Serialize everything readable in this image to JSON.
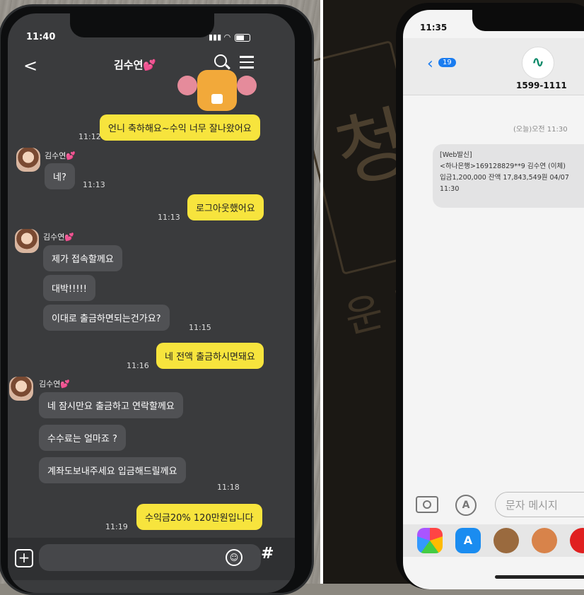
{
  "left_phone": {
    "status_time": "11:40",
    "header_title": "김수연💕",
    "contact_name": "김수연💕",
    "messages": [
      {
        "side": "me",
        "text": "언니 축하해요~수익 너무 잘나왔어요",
        "time": "11:12"
      },
      {
        "side": "them",
        "text": "네?",
        "time": "11:13"
      },
      {
        "side": "me",
        "text": "로그아웃했어요",
        "time": "11:13"
      },
      {
        "side": "them",
        "text": "제가 접속할께요",
        "time": ""
      },
      {
        "side": "them",
        "text": "대박!!!!!",
        "time": ""
      },
      {
        "side": "them",
        "text": "이대로 출금하면되는건가요?",
        "time": "11:15"
      },
      {
        "side": "me",
        "text": "네 전액 출금하시면돼요",
        "time": "11:16"
      },
      {
        "side": "them",
        "text": "네 잠시만요 출금하고 연락할께요",
        "time": ""
      },
      {
        "side": "them",
        "text": "수수료는 얼마죠 ?",
        "time": ""
      },
      {
        "side": "them",
        "text": "계좌도보내주세요  입금해드릴께요",
        "time": "11:18"
      },
      {
        "side": "me",
        "text": "수익금20% 120만원입니다",
        "time": "11:19"
      }
    ]
  },
  "right_phone": {
    "status_time": "11:35",
    "back_count": "19",
    "sender_number": "1599-1111",
    "date_label": "(오늘)오전 11:30",
    "sms_lines": [
      "[Web발신]",
      "<하나은행>169128829**9    김수연  (이체)",
      "입금1,200,000  잔액 17,843,549원    04/07",
      "11:30"
    ],
    "input_placeholder": "문자 메시지"
  },
  "colors": {
    "kakao_yellow": "#f7e43d",
    "dark_bg": "#3a3b3d",
    "ios_blue": "#1a7cf0"
  }
}
